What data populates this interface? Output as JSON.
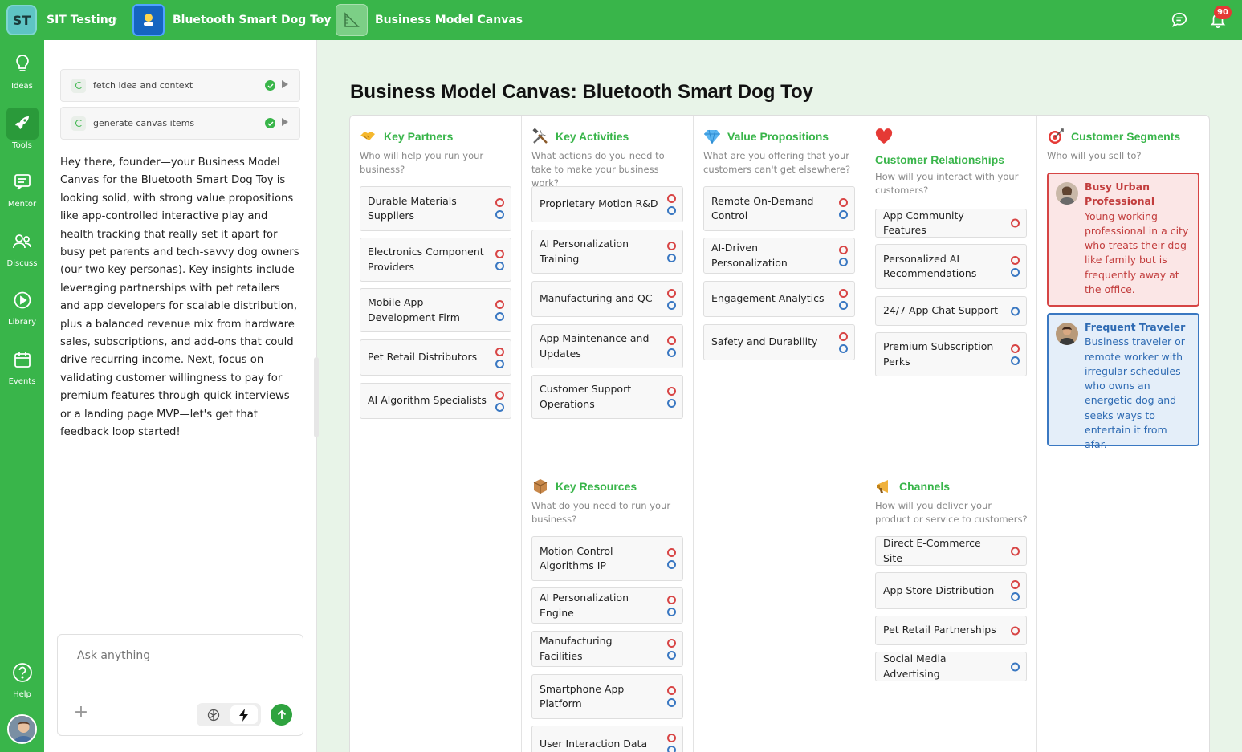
{
  "topbar": {
    "workspace_badge": "ST",
    "workspace_name": "SIT Testing",
    "project_name": "Bluetooth Smart Dog Toy",
    "page_name": "Business Model Canvas",
    "notification_count": "90"
  },
  "rail": {
    "items": [
      {
        "label": "Ideas",
        "icon": "lightbulb-icon"
      },
      {
        "label": "Tools",
        "icon": "rocket-icon"
      },
      {
        "label": "Mentor",
        "icon": "chat-icon"
      },
      {
        "label": "Discuss",
        "icon": "people-icon"
      },
      {
        "label": "Library",
        "icon": "play-icon"
      },
      {
        "label": "Events",
        "icon": "calendar-icon"
      }
    ],
    "help_label": "Help",
    "active": "Tools"
  },
  "chat": {
    "tasks": [
      {
        "label": "fetch idea and context"
      },
      {
        "label": "generate canvas items"
      }
    ],
    "message": "Hey there, founder—your Business Model Canvas for the Bluetooth Smart Dog Toy is looking solid, with strong value propositions like app-controlled interactive play and health tracking that really set it apart for busy pet parents and tech-savvy dog owners (our two key personas). Key insights include leveraging partnerships with pet retailers and app developers for scalable distribution, plus a balanced revenue mix from hardware sales, subscriptions, and add-ons that could drive recurring income. Next, focus on validating customer willingness to pay for premium features through quick interviews or a landing page MVP—let's get that feedback loop started!",
    "input_placeholder": "Ask anything"
  },
  "canvas": {
    "title": "Business Model Canvas: Bluetooth Smart Dog Toy",
    "colors": {
      "accent": "#39b54a",
      "dot_red": "#d84545",
      "dot_blue": "#3a78c2"
    },
    "key_partners": {
      "title": "Key Partners",
      "subtitle": "Who will help you run your business?",
      "items": [
        "Durable Materials Suppliers",
        "Electronics Component Providers",
        "Mobile App Development Firm",
        "Pet Retail Distributors",
        "AI Algorithm Specialists"
      ]
    },
    "key_activities": {
      "title": "Key Activities",
      "subtitle": "What actions do you need to take to make your business work?",
      "items": [
        "Proprietary Motion R&D",
        "AI Personalization Training",
        "Manufacturing and QC",
        "App Maintenance and Updates",
        "Customer Support Operations"
      ]
    },
    "key_resources": {
      "title": "Key Resources",
      "subtitle": "What do you need to run your business?",
      "items": [
        "Motion Control Algorithms IP",
        "AI Personalization Engine",
        "Manufacturing Facilities",
        "Smartphone App Platform",
        "User Interaction Data"
      ]
    },
    "value_propositions": {
      "title": "Value Propositions",
      "subtitle": "What are you offering that your customers can't get elsewhere?",
      "items": [
        "Remote On-Demand Control",
        "AI-Driven Personalization",
        "Engagement Analytics",
        "Safety and Durability"
      ]
    },
    "customer_relationships": {
      "title": "Customer Relationships",
      "subtitle": "How will you interact with your customers?",
      "items": [
        "App Community Features",
        "Personalized AI Recommendations",
        "24/7 App Chat Support",
        "Premium Subscription Perks"
      ]
    },
    "channels": {
      "title": "Channels",
      "subtitle": "How will you deliver your product or service to customers?",
      "items": [
        "Direct E-Commerce Site",
        "App Store Distribution",
        "Pet Retail Partnerships",
        "Social Media Advertising"
      ]
    },
    "customer_segments": {
      "title": "Customer Segments",
      "subtitle": "Who will you sell to?",
      "personas": [
        {
          "name": "Busy Urban Professional",
          "description": "Young working professional in a city who treats their dog like family but is frequently away at the office.",
          "color": "#d64545"
        },
        {
          "name": "Frequent Traveler",
          "description": "Business traveler or remote worker with irregular schedules who owns an energetic dog and seeks ways to entertain it from afar.",
          "color": "#3a78c2"
        }
      ]
    }
  }
}
